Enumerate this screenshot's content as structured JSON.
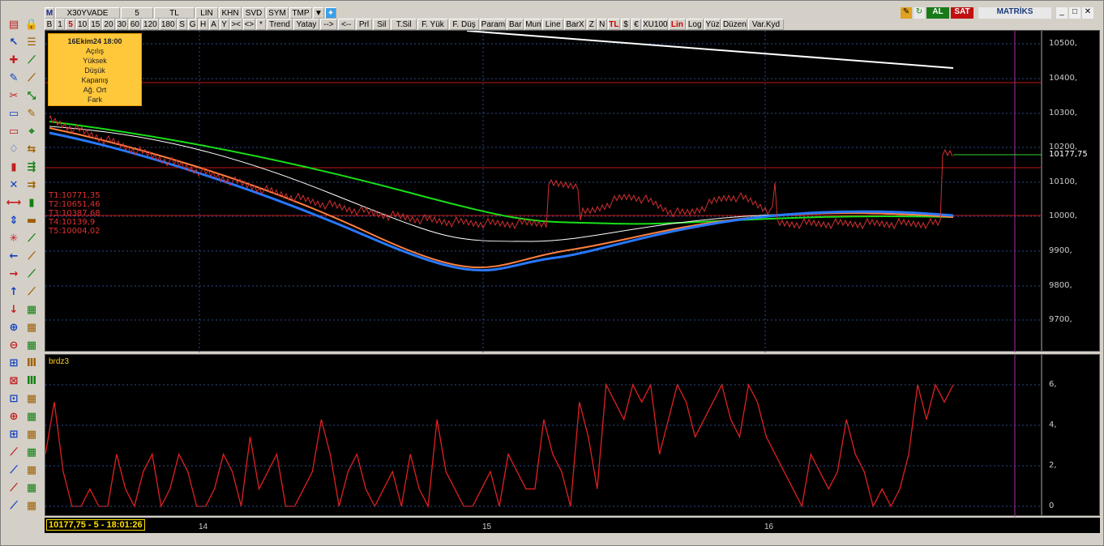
{
  "toolbar_row1": [
    "M",
    "X30YVADE",
    "5",
    "TL",
    "LIN",
    "KHN",
    "SVD",
    "SYM",
    "TMP",
    "▼"
  ],
  "toolbar_row2": [
    "B",
    "1",
    "5",
    "10",
    "15",
    "20",
    "30",
    "60",
    "120",
    "180",
    "S",
    "G",
    "H",
    "A",
    "Y",
    "><",
    "<>",
    "*",
    "Trend",
    "Yatay",
    "-->",
    "<--",
    "Prl",
    "Sil",
    "T.Sil",
    "F. Yük",
    "F. Düş",
    "Param",
    "Bar",
    "Mum",
    "Line",
    "BarX",
    "Z",
    "N",
    "TL",
    "$",
    "€",
    "XU100",
    "Lin",
    "Log",
    "Yüz",
    "Düzen",
    "Var.Kyd"
  ],
  "right_buttons": {
    "buy": "AL",
    "sell": "SAT",
    "brand": "MATRİKS"
  },
  "info_box": {
    "date": "16Ekim24 18:00",
    "rows": [
      "Açılış",
      "Yüksek",
      "Düşük",
      "Kapanış",
      "Ağ. Ort",
      "Fark"
    ]
  },
  "targets": [
    "T1:10771,35",
    "T2:10651,46",
    "T3:10387,68",
    "T4:10139,9",
    "T5:10004,02"
  ],
  "price_axis": [
    "10500,",
    "10400,",
    "10300,",
    "10200,",
    "10100,",
    "10000,",
    "9900,",
    "9800,",
    "9700,"
  ],
  "current_price": "10177,75",
  "indicator_name": "brdz3",
  "indicator_axis": [
    "6,",
    "4,",
    "2,",
    "0"
  ],
  "x_labels": [
    "14",
    "15",
    "16"
  ],
  "status": "10177,75 - 5 - 18:01:26",
  "colors": {
    "ma_green": "#18e018",
    "ma_blue": "#2878ff",
    "ma_orange": "#ff8040",
    "ma_white": "#ffffff",
    "indicator": "#e02020",
    "hline": "#c01818"
  },
  "chart_data": {
    "type": "line",
    "title": "",
    "indicator_values": [
      3,
      6,
      2,
      0,
      0,
      1,
      0,
      0,
      3,
      1,
      0,
      2,
      3,
      0,
      1,
      3,
      2,
      0,
      0,
      1,
      3,
      2,
      0,
      4,
      1,
      2,
      3,
      0,
      0,
      1,
      2,
      5,
      3,
      0,
      2,
      3,
      1,
      0,
      1,
      2,
      0,
      3,
      1,
      0,
      5,
      2,
      1,
      0,
      0,
      1,
      2,
      0,
      3,
      2,
      1,
      1,
      5,
      3,
      2,
      0,
      6,
      4,
      1,
      7,
      6,
      5,
      7,
      6,
      7,
      3,
      5,
      7,
      6,
      4,
      5,
      6,
      7,
      5,
      4,
      7,
      6,
      4,
      3,
      2,
      1,
      0,
      3,
      2,
      1,
      2,
      5,
      3,
      2,
      0,
      1,
      0,
      1,
      3,
      7,
      5,
      7,
      6,
      7
    ],
    "ylim": [
      0,
      7
    ]
  }
}
